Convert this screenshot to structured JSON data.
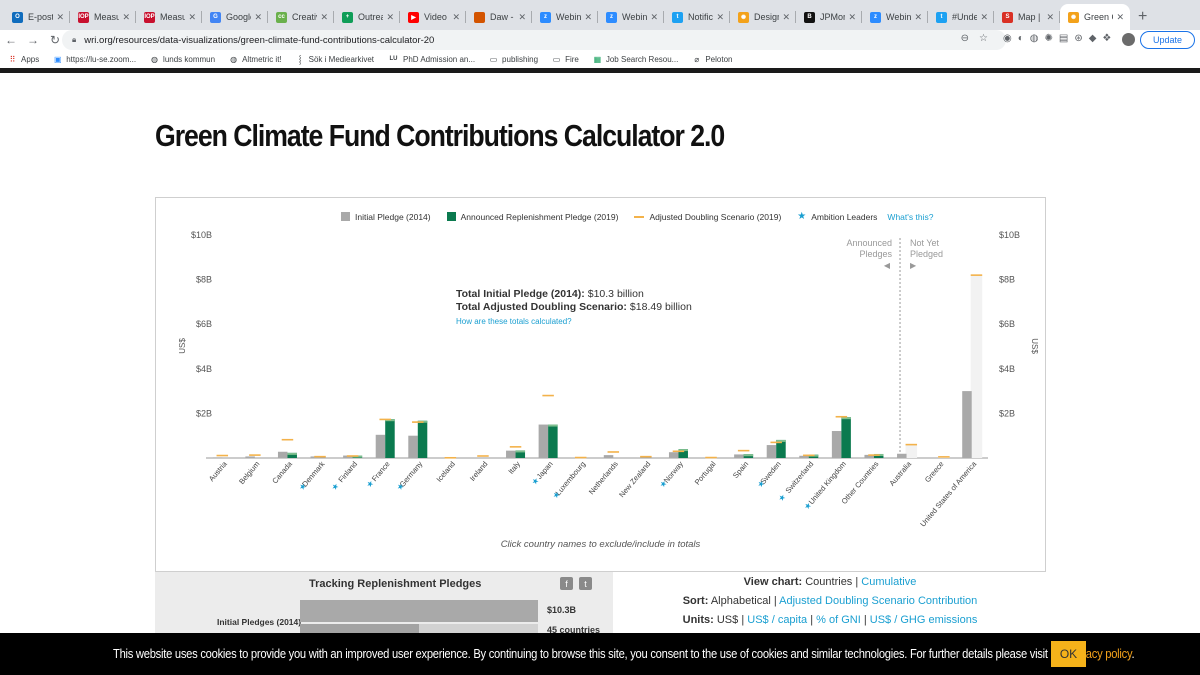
{
  "browser": {
    "tabs": [
      {
        "title": "E-post-",
        "icon": "outlook-icon",
        "color": "#0f6cbd",
        "glyph": "O"
      },
      {
        "title": "Measur",
        "icon": "iop-icon",
        "color": "#c8102e",
        "glyph": "IOP"
      },
      {
        "title": "Measur",
        "icon": "iop-icon",
        "color": "#c8102e",
        "glyph": "IOP"
      },
      {
        "title": "Google",
        "icon": "google-docs-icon",
        "color": "#4285f4",
        "glyph": "G"
      },
      {
        "title": "Creativ",
        "icon": "creative-icon",
        "color": "#6ab04c",
        "glyph": "cc"
      },
      {
        "title": "Outreac",
        "icon": "sheets-icon",
        "color": "#0f9d58",
        "glyph": "+"
      },
      {
        "title": "Video d",
        "icon": "youtube-icon",
        "color": "#ff0000",
        "glyph": "▶"
      },
      {
        "title": "Daw - S",
        "icon": "slides-icon",
        "color": "#d35400",
        "glyph": ""
      },
      {
        "title": "Webina",
        "icon": "zoom-icon",
        "color": "#2d8cff",
        "glyph": "z"
      },
      {
        "title": "Webina",
        "icon": "zoom-icon",
        "color": "#2d8cff",
        "glyph": "z"
      },
      {
        "title": "Notifica",
        "icon": "twitter-icon",
        "color": "#1da1f2",
        "glyph": "t"
      },
      {
        "title": "Design",
        "icon": "wri-icon",
        "color": "#f3a21b",
        "glyph": "✺"
      },
      {
        "title": "JPMorg",
        "icon": "b-icon",
        "color": "#111111",
        "glyph": "B"
      },
      {
        "title": "Webina",
        "icon": "zoom-icon",
        "color": "#2d8cff",
        "glyph": "z"
      },
      {
        "title": "#Under",
        "icon": "twitter-icon",
        "color": "#1da1f2",
        "glyph": "t"
      },
      {
        "title": "Map | E",
        "icon": "map-icon",
        "color": "#d93025",
        "glyph": "S"
      },
      {
        "title": "Green C",
        "icon": "wri-icon",
        "color": "#f3a21b",
        "glyph": "✺",
        "active": true
      }
    ],
    "url": "wri.org/resources/data-visualizations/green-climate-fund-contributions-calculator-20",
    "update_label": "Update",
    "bookmarks": [
      {
        "label": "Apps",
        "icon": "apps-grid-icon"
      },
      {
        "label": "https://lu-se.zoom...",
        "icon": "zoom-icon"
      },
      {
        "label": "lunds kommun",
        "icon": "globe-icon"
      },
      {
        "label": "Altmetric it!",
        "icon": "globe-icon"
      },
      {
        "label": "Sök i Mediearkivet",
        "icon": "mediearkivet-icon"
      },
      {
        "label": "PhD Admission an...",
        "icon": "lu-icon"
      },
      {
        "label": "publishing",
        "icon": "folder-icon"
      },
      {
        "label": "Fire",
        "icon": "folder-icon"
      },
      {
        "label": "Job Search Resou...",
        "icon": "sheets-icon"
      },
      {
        "label": "Peloton",
        "icon": "peloton-icon"
      }
    ]
  },
  "page": {
    "title": "Green Climate Fund Contributions Calculator 2.0"
  },
  "legend": {
    "initial": "Initial Pledge (2014)",
    "announced": "Announced Replenishment Pledge (2019)",
    "adjusted": "Adjusted Doubling Scenario (2019)",
    "leaders": "Ambition Leaders",
    "whats_this": "What's this?"
  },
  "colors": {
    "initial": "#a9a9a9",
    "announced": "#0b7a4f",
    "adjusted": "#f3b24a",
    "star": "#1a9fd1",
    "link": "#1a9fd1",
    "not_yet_bg": "#f2f2f2"
  },
  "totals": {
    "initial_label": "Total Initial Pledge (2014):",
    "initial_value": "$10.3 billion",
    "adjusted_label": "Total Adjusted Doubling Scenario:",
    "adjusted_value": "$18.49 billion",
    "how_link": "How are these totals calculated?"
  },
  "sections": {
    "announced": "Announced Pledges",
    "not_yet": "Not Yet Pledged"
  },
  "chart_data": {
    "type": "bar",
    "ylabel": "US$",
    "ylim": [
      0,
      10
    ],
    "yticks": [
      "$10B",
      "$8B",
      "$6B",
      "$4B",
      "$2B"
    ],
    "ytick_values": [
      10,
      8,
      6,
      4,
      2
    ],
    "categories": [
      "Austria",
      "Belgium",
      "Canada",
      "Denmark",
      "Finland",
      "France",
      "Germany",
      "Iceland",
      "Ireland",
      "Italy",
      "Japan",
      "Luxembourg",
      "Netherlands",
      "New Zealand",
      "Norway",
      "Portugal",
      "Spain",
      "Sweden",
      "Switzerland",
      "United Kingdom",
      "Other Countries",
      "Australia",
      "Greece",
      "United States of America"
    ],
    "ambition_leaders": [
      false,
      false,
      false,
      true,
      true,
      true,
      true,
      false,
      false,
      false,
      true,
      true,
      false,
      false,
      true,
      false,
      false,
      true,
      true,
      true,
      false,
      false,
      false,
      false
    ],
    "pledged": [
      true,
      true,
      true,
      true,
      true,
      true,
      true,
      true,
      true,
      true,
      true,
      true,
      true,
      true,
      true,
      true,
      true,
      true,
      true,
      true,
      true,
      false,
      false,
      false
    ],
    "series": [
      {
        "name": "Initial Pledge (2014)",
        "values": [
          0.03,
          0.07,
          0.28,
          0.07,
          0.11,
          1.04,
          1.0,
          0.001,
          0.003,
          0.33,
          1.5,
          0.005,
          0.13,
          0.003,
          0.26,
          0.002,
          0.16,
          0.58,
          0.1,
          1.21,
          0.14,
          0.19,
          0.001,
          3.0
        ]
      },
      {
        "name": "Announced Replenishment Pledge (2019)",
        "values": [
          0.0,
          0.0,
          0.23,
          0.0,
          0.11,
          1.74,
          1.67,
          0.0,
          0.0,
          0.34,
          1.5,
          0.0,
          0.0,
          0.0,
          0.4,
          0.0,
          0.17,
          0.81,
          0.15,
          1.83,
          0.18,
          0.0,
          0.0,
          0.0
        ]
      },
      {
        "name": "Adjusted Doubling Scenario (2019)",
        "values": [
          0.11,
          0.13,
          0.82,
          0.06,
          0.09,
          1.73,
          1.61,
          0.01,
          0.09,
          0.5,
          2.8,
          0.02,
          0.27,
          0.06,
          0.3,
          0.02,
          0.33,
          0.7,
          0.12,
          1.85,
          0.13,
          0.6,
          0.05,
          8.2
        ]
      }
    ]
  },
  "click_note": "Click country names to exclude/include in totals",
  "tracking": {
    "title": "Tracking Replenishment Pledges",
    "label": "Initial Pledges (2014)",
    "value1": "$10.3B",
    "value2": "45 countries",
    "fill_fraction": 1.0,
    "fill_fraction2": 0.5
  },
  "options": {
    "view_key": "View chart:",
    "view_current": "Countries",
    "view_link": "Cumulative",
    "sort_key": "Sort:",
    "sort_current": "Alphabetical",
    "sort_link": "Adjusted Doubling Scenario Contribution",
    "units_key": "Units:",
    "units_current": "US$",
    "units_link1": "US$ / capita",
    "units_link2": "% of GNI",
    "units_link3": "US$ / GHG emissions",
    "sep": "|"
  },
  "cookie": {
    "text": "This website uses cookies to provide you with an improved user experience. By continuing to browse this site, you consent to the use of cookies and similar technologies. For further details please visit our ",
    "link": "privacy policy",
    "end": ".",
    "ok": "OK"
  }
}
